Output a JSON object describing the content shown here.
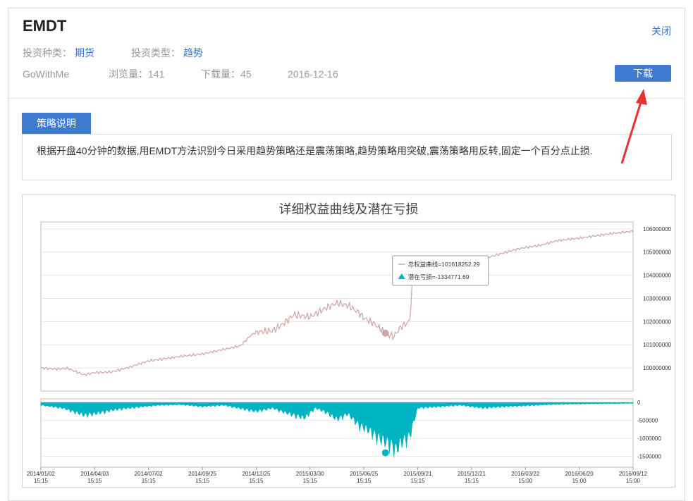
{
  "header": {
    "title": "EMDT",
    "close_label": "关闭",
    "invest_category_label": "投资种类：",
    "invest_category_value": "期货",
    "invest_type_label": "投资类型：",
    "invest_type_value": "趋势",
    "author": "GoWithMe",
    "views": "浏览量：141",
    "downloads": "下载量：45",
    "date": "2016-12-16",
    "download_label": "下载"
  },
  "strategy": {
    "tab_label": "策略说明",
    "description": "根据开盘40分钟的数据,用EMDT方法识别今日采用趋势策略还是震荡策略,趋势策略用突破,震荡策略用反转,固定一个百分点止损."
  },
  "colors": {
    "accent": "#3f79d0",
    "equity_line": "#d4a8a8",
    "drawdown_fill": "#00b3c0",
    "arrow": "#e8322f"
  },
  "chart_data": {
    "type": "line",
    "title": "详细权益曲线及潜在亏损",
    "x_ticks": [
      [
        "2014/01/02",
        "15:15"
      ],
      [
        "2014/04/03",
        "15:15"
      ],
      [
        "2014/07/02",
        "15:15"
      ],
      [
        "2014/09/25",
        "15:15"
      ],
      [
        "2014/12/25",
        "15:15"
      ],
      [
        "2015/03/30",
        "15:15"
      ],
      [
        "2015/06/25",
        "15:15"
      ],
      [
        "2015/09/21",
        "15:15"
      ],
      [
        "2015/12/21",
        "15:15"
      ],
      [
        "2016/03/22",
        "15:00"
      ],
      [
        "2016/06/20",
        "15:00"
      ],
      [
        "2016/09/12",
        "15:00"
      ]
    ],
    "equity_axis": {
      "ticks": [
        "100000000",
        "101000000",
        "102000000",
        "103000000",
        "104000000",
        "105000000",
        "106000000"
      ],
      "ylim": [
        99000000,
        106300000
      ]
    },
    "drawdown_axis": {
      "ticks": [
        "0",
        "-500000",
        "-1000000",
        "-1500000"
      ],
      "ylim": [
        -1800000,
        100000
      ]
    },
    "series": [
      {
        "name": "总权益曲线",
        "x": [
          0,
          0.25,
          0.5,
          0.8,
          1.0,
          1.3,
          1.6,
          2.0,
          2.3,
          2.6,
          3.0,
          3.4,
          3.7,
          3.9,
          4.0,
          4.3,
          4.5,
          4.7,
          5.0,
          5.3,
          5.5,
          5.7,
          5.9,
          6.0,
          6.2,
          6.4,
          6.55,
          6.7,
          6.85,
          6.9,
          7.0,
          7.3,
          7.6,
          8.0,
          8.2,
          8.5,
          8.8,
          9.0,
          9.3,
          9.6,
          10.0,
          10.3,
          10.6,
          11.0
        ],
        "values": [
          100000000,
          99950000,
          99980000,
          99700000,
          99800000,
          99820000,
          100000000,
          100300000,
          100400000,
          100500000,
          100600000,
          100800000,
          100950000,
          101400000,
          101550000,
          101600000,
          101900000,
          102300000,
          102200000,
          102600000,
          102800000,
          102700000,
          102400000,
          102150000,
          101900000,
          101500000,
          101350000,
          101800000,
          102000000,
          103700000,
          104200000,
          104300000,
          104400000,
          104600000,
          104700000,
          104900000,
          105100000,
          105200000,
          105300000,
          105500000,
          105600000,
          105700000,
          105800000,
          105900000
        ]
      },
      {
        "name": "潜在亏损",
        "x": [
          0,
          0.4,
          0.8,
          1.0,
          1.4,
          1.9,
          2.2,
          2.6,
          3.0,
          3.4,
          3.8,
          4.0,
          4.3,
          4.6,
          4.9,
          5.1,
          5.3,
          5.5,
          5.7,
          5.9,
          6.1,
          6.3,
          6.5,
          6.6,
          6.7,
          6.85,
          7.0,
          7.4,
          7.8,
          8.2,
          8.6,
          9.0,
          9.4,
          9.8,
          10.2,
          10.6,
          11.0
        ],
        "values": [
          -100000,
          -200000,
          -450000,
          -400000,
          -250000,
          -150000,
          -100000,
          -80000,
          -150000,
          -100000,
          -250000,
          -320000,
          -200000,
          -400000,
          -550000,
          -200000,
          -350000,
          -600000,
          -400000,
          -800000,
          -1000000,
          -1300000,
          -1500000,
          -1700000,
          -1400000,
          -1200000,
          -200000,
          -150000,
          -100000,
          -200000,
          -150000,
          -120000,
          -80000,
          -60000,
          -50000,
          -40000,
          -30000
        ]
      }
    ],
    "tooltip": {
      "equity_text": "总权益曲线=101618252.29",
      "drawdown_text": "潜在亏损=-1334771.69",
      "x_index": 6.4
    }
  }
}
